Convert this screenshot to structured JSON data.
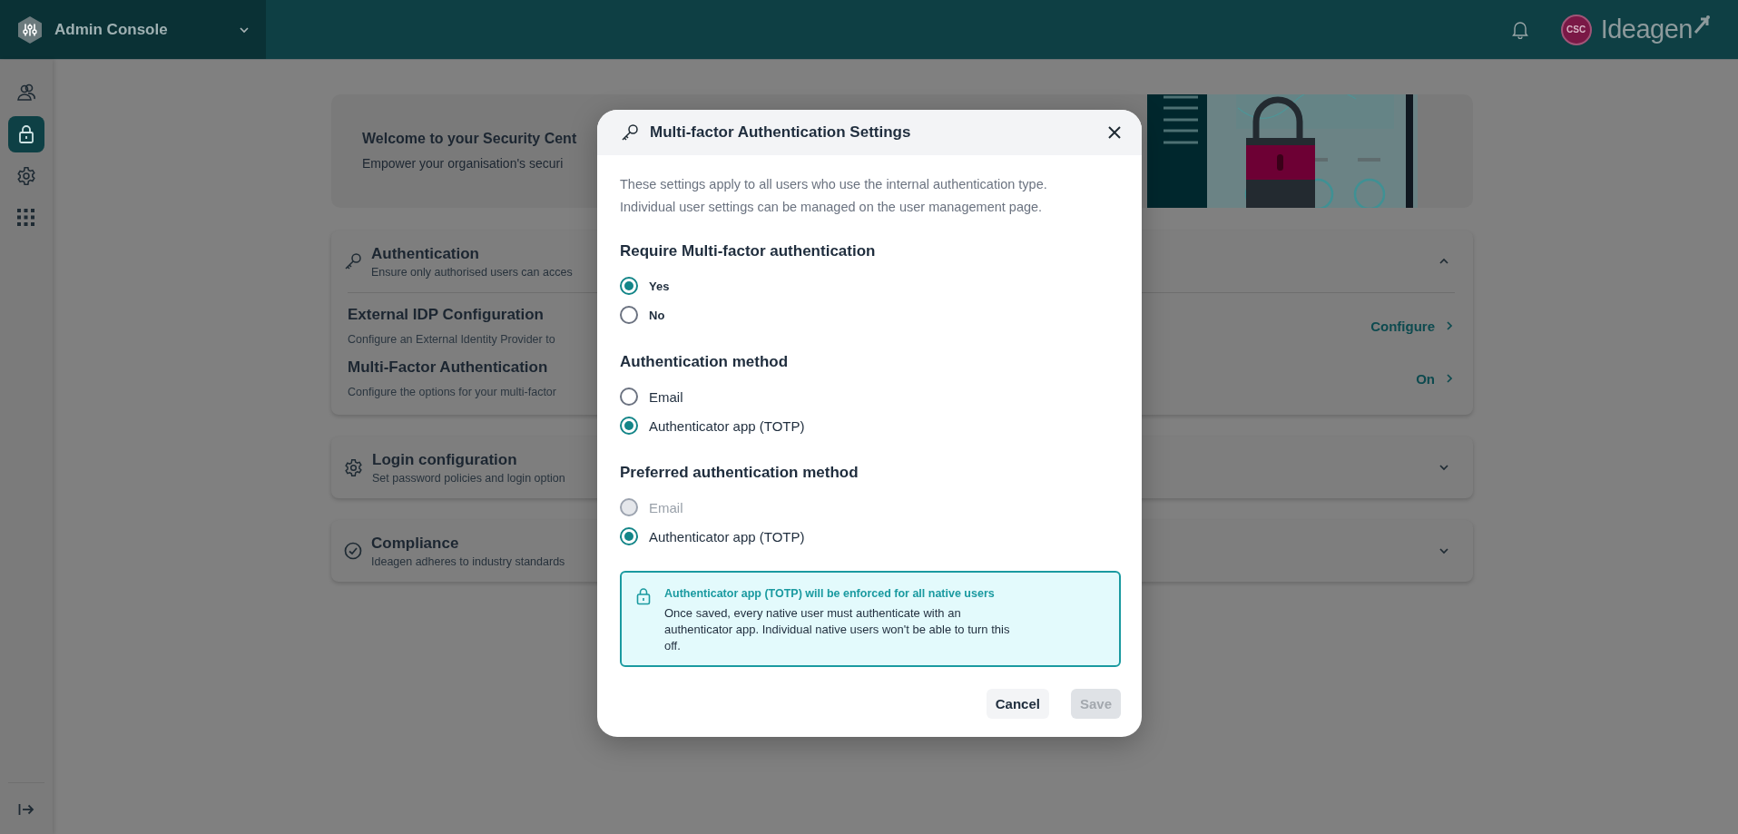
{
  "top_bar": {
    "app_name": "Admin Console",
    "avatar_initials": "CSC",
    "brand": "Ideagen"
  },
  "sidebar": {
    "items": [
      {
        "kind": "users",
        "selected": false
      },
      {
        "kind": "lock",
        "selected": true
      },
      {
        "kind": "gear",
        "selected": false
      },
      {
        "kind": "grid",
        "selected": false
      }
    ]
  },
  "welcome": {
    "title": "Welcome to your Security Cent",
    "subtitle": "Empower your organisation's securi"
  },
  "sections": [
    {
      "kind": "key",
      "title": "Authentication",
      "description": "Ensure only authorised users can acces",
      "expanded": true,
      "items": [
        {
          "title": "External IDP Configuration",
          "description": "Configure an External Identity Provider to",
          "action": "Configure"
        },
        {
          "title": "Multi-Factor Authentication",
          "description": "Configure the options for your multi-factor",
          "action": "On"
        }
      ]
    },
    {
      "kind": "gear",
      "title": "Login configuration",
      "description": "Set password policies and login option",
      "expanded": false
    },
    {
      "kind": "check",
      "title": "Compliance",
      "description": "Ideagen adheres to industry standards",
      "expanded": false
    }
  ],
  "dialog": {
    "title": "Multi-factor Authentication Settings",
    "intro": "These settings apply to all users who use the internal authentication type. Individual user settings can be managed on the user management page.",
    "groups": [
      {
        "heading": "Require Multi-factor authentication",
        "kind": "compact",
        "options": [
          {
            "label": "Yes",
            "selected": true,
            "disabled": false
          },
          {
            "label": "No",
            "selected": false,
            "disabled": false
          }
        ]
      },
      {
        "heading": "Authentication method",
        "kind": "standard",
        "options": [
          {
            "label": "Email",
            "selected": false,
            "disabled": false
          },
          {
            "label": "Authenticator app (TOTP)",
            "selected": true,
            "disabled": false
          }
        ]
      },
      {
        "heading": "Preferred authentication method",
        "kind": "standard",
        "options": [
          {
            "label": "Email",
            "selected": false,
            "disabled": true
          },
          {
            "label": "Authenticator app (TOTP)",
            "selected": true,
            "disabled": false
          }
        ]
      }
    ],
    "notice": {
      "title": "Authenticator app (TOTP) will be enforced for all native users",
      "body": "Once saved, every native user must authenticate with an authenticator app. Individual native users won't be able to turn this off."
    },
    "buttons": [
      {
        "label": "Cancel",
        "disabled": false
      },
      {
        "label": "Save",
        "disabled": true
      }
    ]
  }
}
